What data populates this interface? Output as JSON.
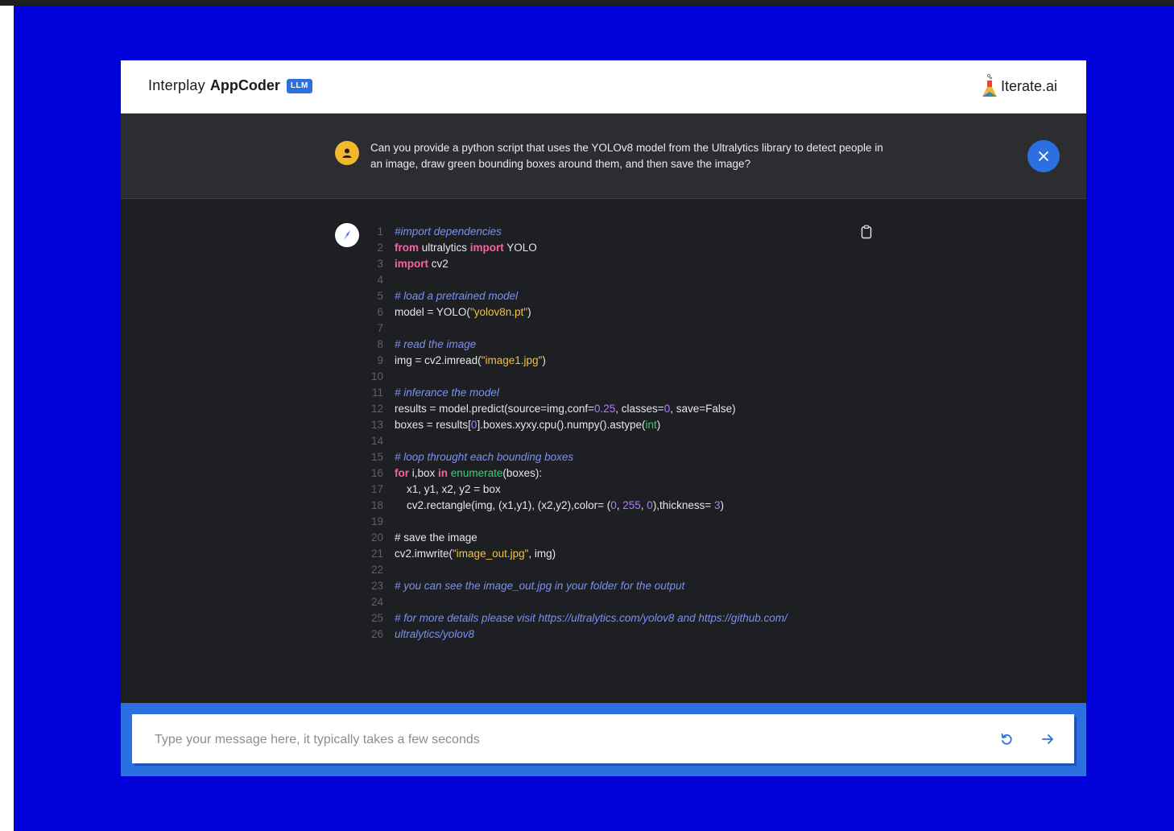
{
  "header": {
    "brand_light": "Interplay",
    "brand_bold": "AppCoder",
    "brand_badge": "LLM",
    "logo_text": "Iterate",
    "logo_suffix": ".ai"
  },
  "question": {
    "text": "Can you provide a python script that uses the YOLOv8 model from the Ultralytics library to detect people in an image, draw green bounding boxes around them, and then save the image?"
  },
  "code": {
    "lines": [
      [
        [
          "c",
          "#import dependencies"
        ]
      ],
      [
        [
          "k",
          "from"
        ],
        [
          "t",
          " ultralytics "
        ],
        [
          "k",
          "import"
        ],
        [
          "t",
          " YOLO"
        ]
      ],
      [
        [
          "k",
          "import"
        ],
        [
          "t",
          " cv2"
        ]
      ],
      [],
      [
        [
          "c",
          "# load a pretrained model"
        ]
      ],
      [
        [
          "t",
          "model = YOLO("
        ],
        [
          "s",
          "\"yolov8n.pt\""
        ],
        [
          "t",
          ")"
        ]
      ],
      [],
      [
        [
          "c",
          "# read the image"
        ]
      ],
      [
        [
          "t",
          "img = cv2.imread("
        ],
        [
          "s",
          "\"image1.jpg\""
        ],
        [
          "t",
          ")"
        ]
      ],
      [],
      [
        [
          "c",
          "# inferance the model"
        ]
      ],
      [
        [
          "t",
          "results = model.predict(source=img,conf="
        ],
        [
          "n",
          "0.25"
        ],
        [
          "t",
          ", classes="
        ],
        [
          "n",
          "0"
        ],
        [
          "t",
          ", save=False)"
        ]
      ],
      [
        [
          "t",
          "boxes = results["
        ],
        [
          "n",
          "0"
        ],
        [
          "t",
          "].boxes.xyxy.cpu().numpy().astype("
        ],
        [
          "b",
          "int"
        ],
        [
          "t",
          ")"
        ]
      ],
      [],
      [
        [
          "c",
          "# loop throught each bounding boxes"
        ]
      ],
      [
        [
          "k",
          "for"
        ],
        [
          "t",
          " i,box "
        ],
        [
          "k",
          "in"
        ],
        [
          "t",
          " "
        ],
        [
          "b",
          "enumerate"
        ],
        [
          "t",
          "(boxes):"
        ]
      ],
      [
        [
          "t",
          "    x1, y1, x2, y2 = box"
        ]
      ],
      [
        [
          "t",
          "    cv2.rectangle(img, (x1,y1), (x2,y2),color= ("
        ],
        [
          "n",
          "0"
        ],
        [
          "t",
          ", "
        ],
        [
          "n",
          "255"
        ],
        [
          "t",
          ", "
        ],
        [
          "n",
          "0"
        ],
        [
          "t",
          "),thickness= "
        ],
        [
          "n",
          "3"
        ],
        [
          "t",
          ")"
        ]
      ],
      [],
      [
        [
          "t",
          "# save the image"
        ]
      ],
      [
        [
          "t",
          "cv2.imwrite("
        ],
        [
          "s",
          "\"image_out.jpg\""
        ],
        [
          "t",
          ", img)"
        ]
      ],
      [],
      [
        [
          "c",
          "# you can see the image_out.jpg in your folder for the output"
        ]
      ],
      [],
      [
        [
          "c",
          "# for more details please visit https://ultralytics.com/yolov8 and https://github.com/"
        ]
      ],
      [
        [
          "c",
          "ultralytics/yolov8"
        ]
      ]
    ]
  },
  "input": {
    "placeholder": "Type your message here, it typically takes a few seconds",
    "value": ""
  },
  "icons": {
    "user": "person-icon",
    "bot": "compass-icon",
    "close": "close-icon",
    "copy": "clipboard-icon",
    "retry": "refresh-icon",
    "send": "arrow-right-icon"
  },
  "colors": {
    "page_bg": "#0000d8",
    "accent": "#2b6fe0",
    "question_bg": "#2b2d31",
    "answer_bg": "#1d1f22",
    "user_avatar": "#f3b82e"
  }
}
